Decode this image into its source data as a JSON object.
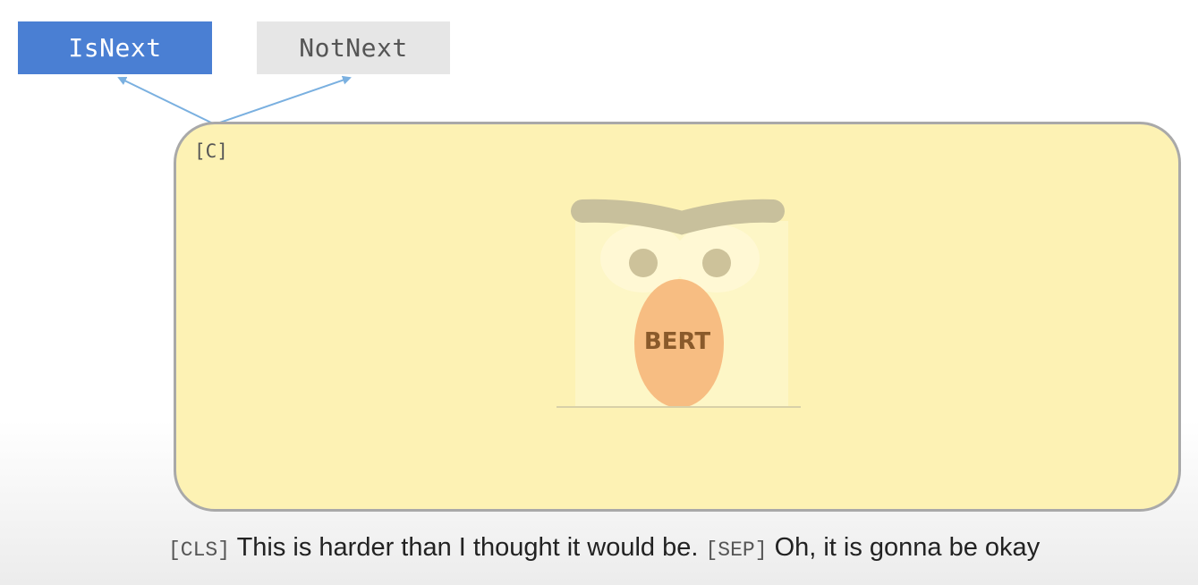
{
  "labels": {
    "is_next": "IsNext",
    "not_next": "NotNext"
  },
  "panel": {
    "token_tag": "[C]",
    "model_name": "BERT"
  },
  "caption": {
    "cls_token": "[CLS]",
    "sentence_a": "This is harder than I thought it would be.",
    "sep_token": "[SEP]",
    "sentence_b": "Oh, it is gonna be okay"
  },
  "colors": {
    "is_next_box": "#4a7fd3",
    "not_next_box": "#e6e6e6",
    "panel_fill": "#fdf2b4",
    "panel_border": "#a9a9a9",
    "arrow": "#7ab0e0",
    "nose": "#f7bd82",
    "brow": "#c8c09c"
  }
}
